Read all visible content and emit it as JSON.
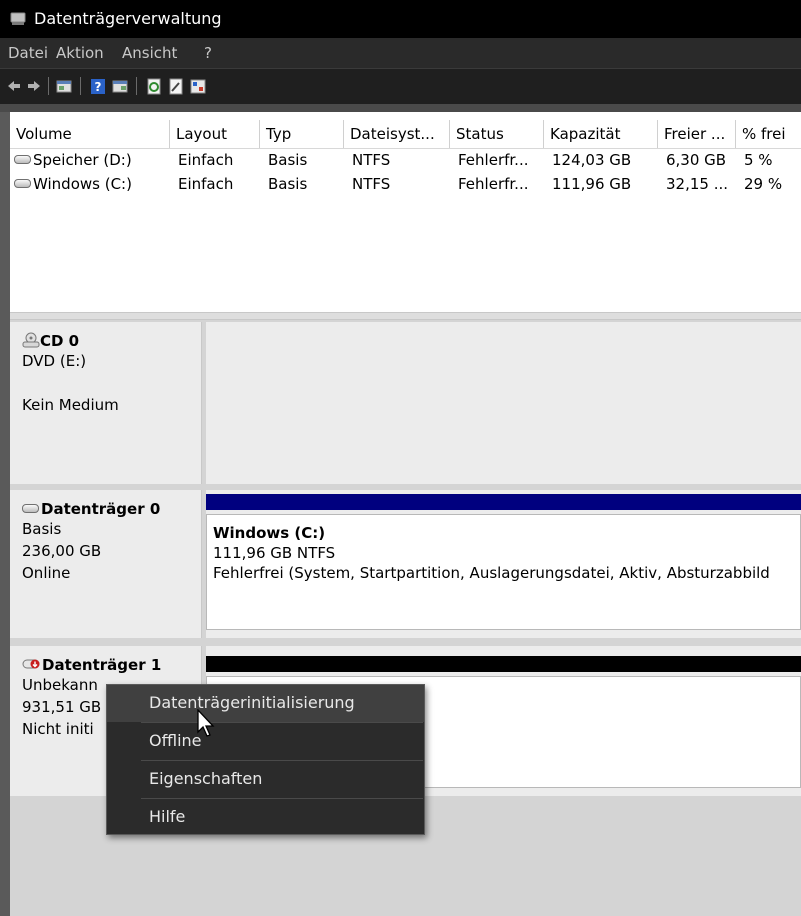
{
  "window": {
    "title": "Datenträgerverwaltung"
  },
  "menubar": {
    "items": [
      "Datei",
      "Aktion",
      "Ansicht",
      "?"
    ]
  },
  "toolbar": {
    "icons": [
      "back-arrow-icon",
      "forward-arrow-icon",
      "console-icon",
      "help-icon",
      "list-view-icon",
      "refresh-icon",
      "properties-icon",
      "rescan-icon"
    ]
  },
  "volume_list": {
    "columns": [
      "Volume",
      "Layout",
      "Typ",
      "Dateisyst...",
      "Status",
      "Kapazität",
      "Freier ...",
      "% frei"
    ],
    "rows": [
      [
        "Speicher (D:)",
        "Einfach",
        "Basis",
        "NTFS",
        "Fehlerfr...",
        "124,03 GB",
        "6,30 GB",
        "5 %"
      ],
      [
        "Windows (C:)",
        "Einfach",
        "Basis",
        "NTFS",
        "Fehlerfr...",
        "111,96 GB",
        "32,15 ...",
        "29 %"
      ]
    ]
  },
  "disks": {
    "cd0": {
      "name": "CD 0",
      "line1": "DVD (E:)",
      "line2": "Kein Medium"
    },
    "disk0": {
      "name": "Datenträger 0",
      "type": "Basis",
      "size": "236,00 GB",
      "state": "Online",
      "partition": {
        "title": "Windows  (C:)",
        "size": "111,96 GB NTFS",
        "status": "Fehlerfrei (System, Startpartition, Auslagerungsdatei, Aktiv, Absturzabbild"
      }
    },
    "disk1": {
      "name": "Datenträger 1",
      "type": "Unbekann",
      "size": "931,51 GB",
      "state": "Nicht initi"
    }
  },
  "context_menu": {
    "items": [
      "Datenträgerinitialisierung",
      "Offline",
      "Eigenschaften",
      "Hilfe"
    ]
  },
  "colors": {
    "disk0_bar": "#00007f",
    "disk1_bar": "#000000",
    "menu_bg": "#2b2b2b",
    "menu_highlight": "#404040"
  }
}
